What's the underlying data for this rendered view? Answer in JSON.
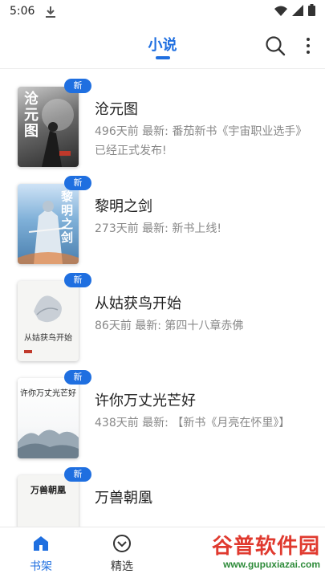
{
  "status_bar": {
    "time": "5:06"
  },
  "header": {
    "title": "小说"
  },
  "books": [
    {
      "title": "沧元图",
      "meta": "496天前 最新: 番茄新书《宇宙职业选手》已经正式发布!",
      "badge": "新",
      "cover_title": "沧元图"
    },
    {
      "title": "黎明之剑",
      "meta": "273天前 最新: 新书上线!",
      "badge": "新",
      "cover_title": "黎明之剑"
    },
    {
      "title": "从姑获鸟开始",
      "meta": "86天前 最新: 第四十八章赤佛",
      "badge": "新",
      "cover_title": "从姑获鸟开始"
    },
    {
      "title": "许你万丈光芒好",
      "meta": "438天前 最新: 【新书《月亮在怀里》】",
      "badge": "新",
      "cover_title": "许你万丈光芒好"
    },
    {
      "title": "万兽朝凰",
      "meta": "",
      "badge": "新",
      "cover_title": "万兽朝凰"
    }
  ],
  "bottom_nav": [
    {
      "label": "书架",
      "icon": "home-icon",
      "active": true
    },
    {
      "label": "精选",
      "icon": "compass-icon",
      "active": false
    }
  ],
  "watermark": {
    "main": "谷普软件园",
    "sub": "www.gupuxiazai.com"
  },
  "colors": {
    "accent": "#1f6fe0",
    "meta_text": "#888888",
    "watermark_red": "#e03a2f",
    "watermark_green": "#2e8b3a"
  }
}
